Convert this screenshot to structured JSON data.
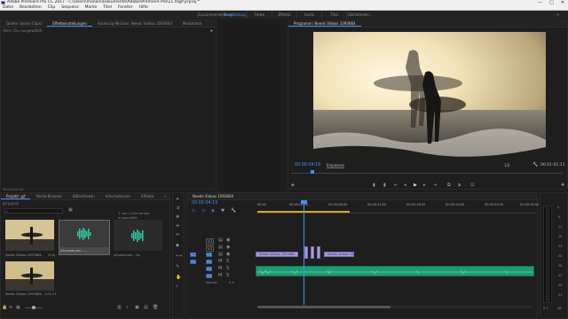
{
  "titlebar": {
    "title": "Adobe Premiere Pro CC 2017 - C:\\Users\\mohani\\Dokumente\\Adobe\\Premiere Pro\\11.0\\gif.prproj *",
    "min": "—",
    "max": "□",
    "close": "✕"
  },
  "menu": [
    "Datei",
    "Bearbeiten",
    "Clip",
    "Sequenz",
    "Marke",
    "Titel",
    "Fenster",
    "Hilfe"
  ],
  "workspaces": [
    {
      "label": "Zusammenstellung",
      "active": false
    },
    {
      "label": "Bearbeitung",
      "active": true
    },
    {
      "label": "Farbe",
      "active": false
    },
    {
      "label": "Effekte",
      "active": false
    },
    {
      "label": "Audio",
      "active": false
    },
    {
      "label": "Titel",
      "active": false
    },
    {
      "label": "Bibliotheken",
      "active": false
    }
  ],
  "workspace_more": "»",
  "source_panel": {
    "tabs": [
      "Quelle: (keine Clips)",
      "Effekteinstellungen",
      "Audioclip-Mischer: Needs Videos 1093664",
      "Metadaten"
    ],
    "active_tab": 1,
    "subtext": "(Kein Clip ausgewählt)",
    "timecode": "00:00:04:19"
  },
  "program": {
    "title": "Programm: Needs Videos 1093664",
    "timecode": "00:00:04:19",
    "fit": "Einpassen",
    "quality": "1/2",
    "duration": "00:01:01:11"
  },
  "project": {
    "tabs": [
      "Projekt: gif",
      "Media-Browser",
      "Bibliotheken",
      "Informationen",
      "Effekte"
    ],
    "more": "»",
    "file": "gif.prproj",
    "selection": "1 von 4 Elementen ausgewählt",
    "items": [
      {
        "name": "Needs Videos 1093664...",
        "dur": "9:16",
        "kind": "video"
      },
      {
        "name": "p3vcaab.com - ...",
        "dur": "1:05:10",
        "kind": "audio"
      },
      {
        "name": "p3vaxa.com - (w...",
        "dur": "1:05:11292",
        "kind": "audio"
      },
      {
        "name": "Needs Videos 1093664...",
        "dur": "1:01:11",
        "kind": "video"
      }
    ]
  },
  "timeline": {
    "title": "Needs Videos 1093664",
    "timecode": "00:00:04:19",
    "ruler": [
      "00:00",
      "00:00:04:00",
      "00:00:08:00",
      "00:00:12:00",
      "00:00:16:00",
      "00:00:20:00",
      "00:00:24:00",
      "00:00:28:00"
    ],
    "tracks": [
      "V3",
      "V2",
      "V1",
      "A1",
      "A2",
      "A3"
    ],
    "clips": {
      "v1_a": "Needs Videos 1093664",
      "v1_b": "Needs Videos 1093664"
    },
    "master_label": "Master",
    "master_val": "0.0"
  },
  "vu_scale": [
    "0",
    "-6",
    "-12",
    "-18",
    "-24",
    "-30",
    "-36",
    "-42",
    "-48",
    "-54"
  ],
  "vu_bottom": "dB"
}
